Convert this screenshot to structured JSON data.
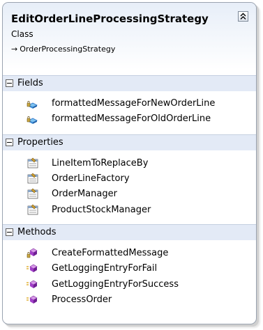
{
  "class": {
    "name": "EditOrderLineProcessingStrategy",
    "stereotype": "Class",
    "base_arrow": "→",
    "base_class": "OrderProcessingStrategy"
  },
  "sections": {
    "fields": {
      "label": "Fields",
      "items": [
        {
          "label": "formattedMessageForNewOrderLine",
          "icon": "private-field-icon"
        },
        {
          "label": "formattedMessageForOldOrderLine",
          "icon": "private-field-icon"
        }
      ]
    },
    "properties": {
      "label": "Properties",
      "items": [
        {
          "label": "LineItemToReplaceBy",
          "icon": "property-icon"
        },
        {
          "label": "OrderLineFactory",
          "icon": "property-icon"
        },
        {
          "label": "OrderManager",
          "icon": "property-icon"
        },
        {
          "label": "ProductStockManager",
          "icon": "property-icon"
        }
      ]
    },
    "methods": {
      "label": "Methods",
      "items": [
        {
          "label": "CreateFormattedMessage",
          "icon": "private-method-icon"
        },
        {
          "label": "GetLoggingEntryForFail",
          "icon": "protected-method-icon"
        },
        {
          "label": "GetLoggingEntryForSuccess",
          "icon": "protected-method-icon"
        },
        {
          "label": "ProcessOrder",
          "icon": "protected-method-icon"
        }
      ]
    }
  },
  "colors": {
    "header_gradient_top": "#e7eef8",
    "section_header": "#e3eaf6",
    "border": "#9aa3b0",
    "method_purple": "#a23fc9",
    "field_blue": "#2c74c8"
  }
}
